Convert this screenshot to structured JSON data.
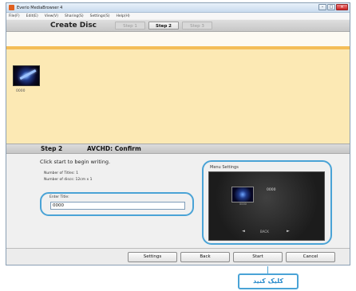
{
  "window": {
    "title": "Everio MediaBrowser 4",
    "controls": {
      "minimize": "–",
      "maximize": "□",
      "close": "×"
    }
  },
  "menubar": [
    "File(F)",
    "Edit(E)",
    "View(V)",
    "Sharing(S)",
    "Settings(S)",
    "Help(H)"
  ],
  "header": {
    "heading": "Create Disc",
    "steps": [
      {
        "label": "Step 1",
        "active": false
      },
      {
        "label": "Step 2",
        "active": true
      },
      {
        "label": "Step 3",
        "active": false
      }
    ]
  },
  "thumbnails": [
    {
      "caption": "0000"
    }
  ],
  "step_section": {
    "step_label": "Step 2",
    "step_name": "AVCHD: Confirm",
    "instruction": "Click start to begin writing.",
    "number_of_titles": "Number of Titles: 1",
    "number_of_discs": "Number of discs: 12cm x 1"
  },
  "title_field": {
    "label": "Enter Title:",
    "value": "0000"
  },
  "menu_settings": {
    "label": "Menu Settings",
    "preview_title": "0000",
    "thumb_caption": "0000",
    "nav_prev": "◄",
    "nav_back": "BACK",
    "nav_next": "►"
  },
  "buttons": {
    "settings": "Settings",
    "back": "Back",
    "start": "Start",
    "cancel": "Cancel"
  },
  "callout": {
    "text": "کلیک کنید"
  },
  "colors": {
    "callout_accent": "#4aa3d6",
    "thumbnail_area": "#fce9b4",
    "orange_strip": "#f4be58"
  }
}
